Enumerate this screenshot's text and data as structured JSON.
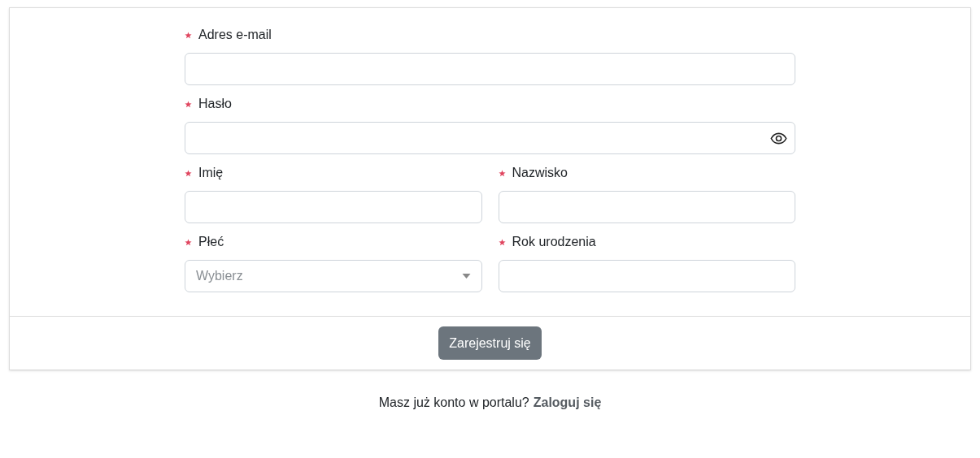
{
  "form": {
    "rows": [
      [
        {
          "kind": "text",
          "label": "Adres e-mail",
          "required": true
        }
      ],
      [
        {
          "kind": "password",
          "label": "Hasło",
          "required": true
        }
      ],
      [
        {
          "kind": "text",
          "label": "Imię",
          "required": true
        },
        {
          "kind": "text",
          "label": "Nazwisko",
          "required": true
        }
      ],
      [
        {
          "kind": "select",
          "label": "Płeć",
          "required": true,
          "placeholder": "Wybierz"
        },
        {
          "kind": "text",
          "label": "Rok urodzenia",
          "required": true
        }
      ]
    ]
  },
  "submit_button": "Zarejestruj się",
  "footer": {
    "text": "Masz już konto w portalu?",
    "link": "Zaloguj się"
  }
}
